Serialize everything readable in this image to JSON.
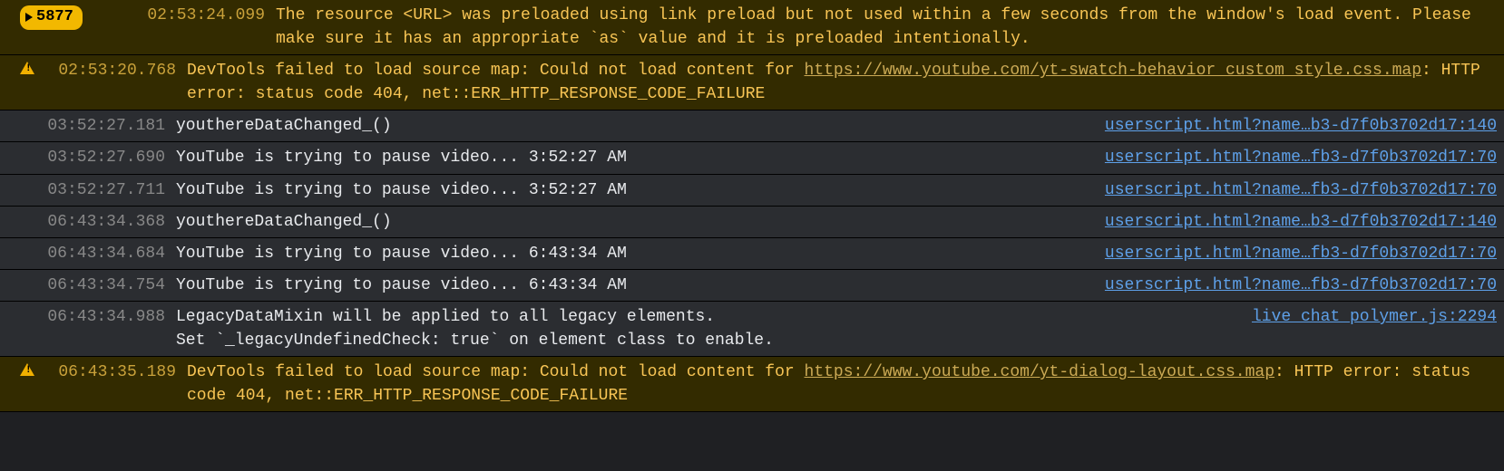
{
  "badge": {
    "count": "5877"
  },
  "rows": [
    {
      "type": "warn",
      "badge": true,
      "ts": "02:53:24.099",
      "msg_plain": "The resource <URL> was preloaded using link preload but not used within a few seconds from the window's load event. Please make sure it has an appropriate `as` value and it is preloaded intentionally."
    },
    {
      "type": "warn",
      "icon": true,
      "ts": "02:53:20.768",
      "msg_pre": "DevTools failed to load source map: Could not load content for ",
      "msg_link": "https://www.youtube.com/yt-swatch-behavior_custom_style.css.map",
      "msg_post": ": HTTP error: status code 404, net::ERR_HTTP_RESPONSE_CODE_FAILURE"
    },
    {
      "type": "log",
      "ts": "03:52:27.181",
      "msg_plain": "youthereDataChanged_()",
      "src": "userscript.html?name…b3-d7f0b3702d17:140"
    },
    {
      "type": "log",
      "ts": "03:52:27.690",
      "msg_plain": "YouTube is trying to pause video... 3:52:27 AM",
      "src": "userscript.html?name…fb3-d7f0b3702d17:70"
    },
    {
      "type": "log",
      "ts": "03:52:27.711",
      "msg_plain": "YouTube is trying to pause video... 3:52:27 AM",
      "src": "userscript.html?name…fb3-d7f0b3702d17:70"
    },
    {
      "type": "log",
      "ts": "06:43:34.368",
      "msg_plain": "youthereDataChanged_()",
      "src": "userscript.html?name…b3-d7f0b3702d17:140"
    },
    {
      "type": "log",
      "ts": "06:43:34.684",
      "msg_plain": "YouTube is trying to pause video... 6:43:34 AM",
      "src": "userscript.html?name…fb3-d7f0b3702d17:70"
    },
    {
      "type": "log",
      "ts": "06:43:34.754",
      "msg_plain": "YouTube is trying to pause video... 6:43:34 AM",
      "src": "userscript.html?name…fb3-d7f0b3702d17:70"
    },
    {
      "type": "log",
      "ts": "06:43:34.988",
      "msg_plain": "LegacyDataMixin will be applied to all legacy elements.\nSet `_legacyUndefinedCheck: true` on element class to enable.",
      "src": "live_chat_polymer.js:2294"
    },
    {
      "type": "warn",
      "icon": true,
      "ts": "06:43:35.189",
      "msg_pre": "DevTools failed to load source map: Could not load content for ",
      "msg_link": "https://www.youtube.com/yt-dialog-layout.css.map",
      "msg_post": ": HTTP error: status code 404, net::ERR_HTTP_RESPONSE_CODE_FAILURE"
    }
  ]
}
